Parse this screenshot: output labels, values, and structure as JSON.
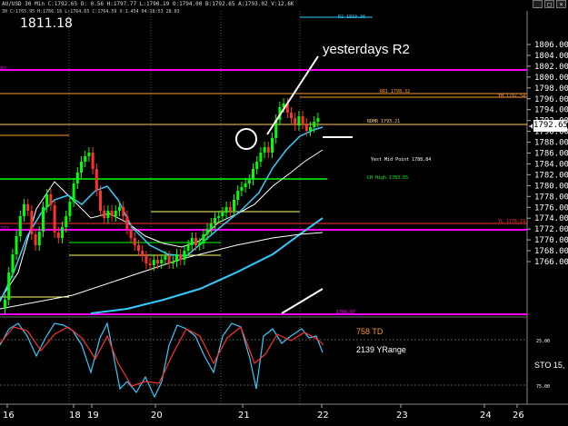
{
  "window": {
    "title": "AU/USD 30 Min  C:1792.65  O: 0.56  H:1797.77  L:1790.19  O:1794.00  B:1792.65  A:1793.02  V:12.6K",
    "buttons": [
      "_",
      "□",
      "×"
    ]
  },
  "ohlc_line": "30  C:1765.95  H:1766.16  L:1764.65  C:1764.59  V:1.454  04:16:53  28.03",
  "big_price": "1811.18",
  "annotation": "yesterdays R2",
  "current_price": "1792.65",
  "level_labels": {
    "r2": "R2 1810.36",
    "r1": "RR1 1798.32",
    "yh": "YH 1797.54",
    "rdhr": "RDHR 1793.21",
    "mid": "Yest Mid Point 1788.84",
    "lh": "LH High 1783.65",
    "yl": "YL 1776.19",
    "left_pink": "R3",
    "left_772": "772",
    "bottom": "1766.87"
  },
  "indicator": {
    "td": "758 TD",
    "yrange": "2139 YRange",
    "sto": "STO 15,"
  },
  "colors": {
    "background": "#000000",
    "magenta": "#ff00ff",
    "orange": "#ff9933",
    "yellow": "#ffff66",
    "green": "#00ff00",
    "cyan": "#33ccff",
    "red": "#ff3030",
    "white": "#ffffff"
  },
  "chart_data": {
    "type": "candlestick",
    "y_ticks": [
      "1806.00",
      "1804.00",
      "1802.00",
      "1800.00",
      "1798.00",
      "1796.00",
      "1794.00",
      "1792.00",
      "1790.00",
      "1788.00",
      "1786.00",
      "1784.00",
      "1782.00",
      "1780.00",
      "1778.00",
      "1776.00",
      "1774.00",
      "1772.00",
      "1770.00",
      "1768.00",
      "1766.00"
    ],
    "x_ticks": [
      "16",
      "18",
      "19",
      "20",
      "21",
      "22",
      "23",
      "24",
      "26"
    ],
    "osc_ticks": [
      "25.00",
      "75.00"
    ]
  }
}
